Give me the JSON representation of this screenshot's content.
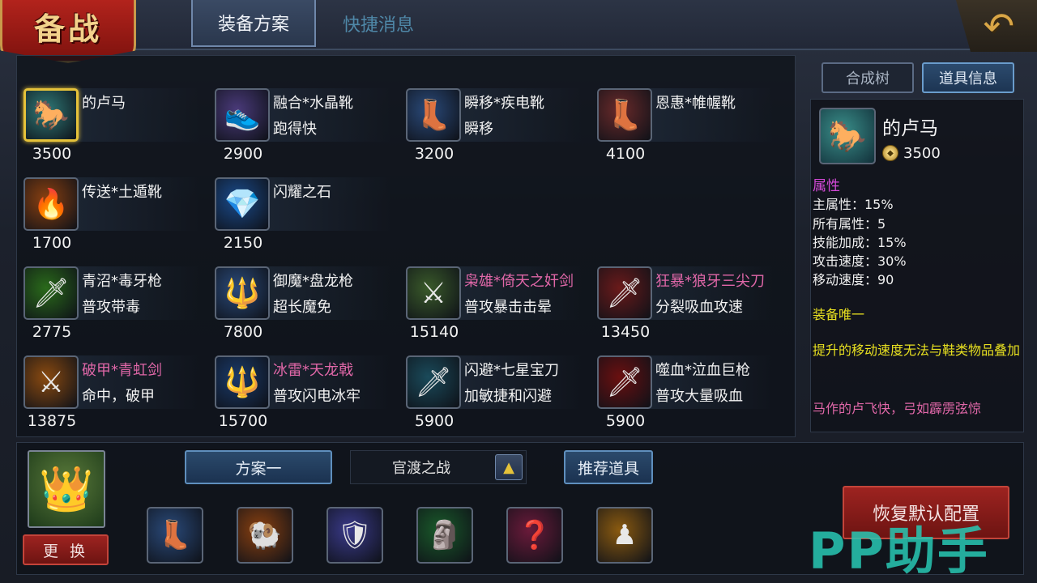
{
  "header": {
    "title": "备战",
    "tabs": [
      {
        "label": "装备方案",
        "active": true
      },
      {
        "label": "快捷消息",
        "active": false
      }
    ],
    "back_icon": "back-arrow-icon"
  },
  "items": [
    {
      "name": "的卢马",
      "desc": "",
      "price": "3500",
      "icon": "🐎",
      "bg": "#2f7a78",
      "selected": true,
      "rare": false
    },
    {
      "name": "融合*水晶靴",
      "desc": "跑得快",
      "price": "2900",
      "icon": "👟",
      "bg": "#4a3a7a",
      "selected": false,
      "rare": false
    },
    {
      "name": "瞬移*疾电靴",
      "desc": "瞬移",
      "price": "3200",
      "icon": "👢",
      "bg": "#2a4a7a",
      "selected": false,
      "rare": false
    },
    {
      "name": "恩惠*帷幄靴",
      "desc": "",
      "price": "4100",
      "icon": "👢",
      "bg": "#6a2a2a",
      "selected": false,
      "rare": false
    },
    {
      "name": "传送*土遁靴",
      "desc": "",
      "price": "1700",
      "icon": "🔥",
      "bg": "#8a4010",
      "selected": false,
      "rare": false
    },
    {
      "name": "闪耀之石",
      "desc": "",
      "price": "2150",
      "icon": "💎",
      "bg": "#1a4a8a",
      "selected": false,
      "rare": false
    },
    {
      "name": "青沼*毒牙枪",
      "desc": "普攻带毒",
      "price": "2775",
      "icon": "🗡",
      "bg": "#2a6a1a",
      "selected": false,
      "rare": false
    },
    {
      "name": "御魔*盘龙枪",
      "desc": "超长魔免",
      "price": "7800",
      "icon": "🔱",
      "bg": "#2a4a7a",
      "selected": false,
      "rare": false
    },
    {
      "name": "枭雄*倚天之奸剑",
      "desc": "普攻暴击击晕",
      "price": "15140",
      "icon": "⚔",
      "bg": "#3a5a2a",
      "selected": false,
      "rare": true
    },
    {
      "name": "狂暴*狼牙三尖刀",
      "desc": "分裂吸血攻速",
      "price": "13450",
      "icon": "🗡",
      "bg": "#6a1a1a",
      "selected": false,
      "rare": true
    },
    {
      "name": "破甲*青虹剑",
      "desc": "命中，破甲",
      "price": "13875",
      "icon": "⚔",
      "bg": "#8a4a10",
      "selected": false,
      "rare": true
    },
    {
      "name": "冰雷*天龙戟",
      "desc": "普攻闪电冰牢",
      "price": "15700",
      "icon": "🔱",
      "bg": "#1a3a6a",
      "selected": false,
      "rare": true
    },
    {
      "name": "闪避*七星宝刀",
      "desc": "加敏捷和闪避",
      "price": "5900",
      "icon": "🗡",
      "bg": "#1a4a5a",
      "selected": false,
      "rare": false
    },
    {
      "name": "噬血*泣血巨枪",
      "desc": "普攻大量吸血",
      "price": "5900",
      "icon": "🗡",
      "bg": "#6a1010",
      "selected": false,
      "rare": false
    }
  ],
  "info": {
    "tabs": [
      "合成树",
      "道具信息"
    ],
    "active_tab": "道具信息",
    "name": "的卢马",
    "price": "3500",
    "icon": "🐎",
    "attr_header": "属性",
    "attrs": [
      "主属性：15%",
      "所有属性：5",
      "技能加成：15%",
      "攻击速度：30%",
      "移动速度：90"
    ],
    "unique": "装备唯一",
    "note": "提升的移动速度无法与鞋类物品叠加",
    "flavor": "马作的卢飞快，弓如霹雳弦惊"
  },
  "loadout": {
    "hero_icon": "👑",
    "replace_label": "更 换",
    "plan_label": "方案一",
    "battle_label": "官渡之战",
    "recommend_label": "推荐道具",
    "restore_label": "恢复默认配置",
    "slots": [
      {
        "icon": "👢",
        "bg": "#2a4a7a"
      },
      {
        "icon": "🐏",
        "bg": "#8a4010"
      },
      {
        "icon": "🛡",
        "bg": "#3a3a8a"
      },
      {
        "icon": "🗿",
        "bg": "#1a5a2a"
      },
      {
        "icon": "❓",
        "bg": "#6a1a3a"
      },
      {
        "icon": "♟",
        "bg": "#8a5a10"
      }
    ]
  },
  "watermark": "PP助手"
}
